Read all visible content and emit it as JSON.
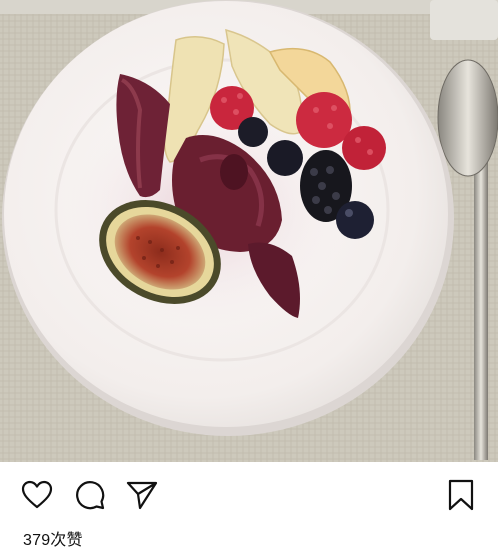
{
  "post": {
    "image_subject": "plate-of-poached-pears-fig-and-berries"
  },
  "actions": {
    "like_icon": "heart-icon",
    "comment_icon": "comment-icon",
    "share_icon": "send-icon",
    "save_icon": "bookmark-icon"
  },
  "likes": {
    "text": "379次赞"
  },
  "colors": {
    "plate": "#f7f3f1",
    "tablecloth": "#cfcbbf",
    "poached_pear": "#6e2236",
    "fig_flesh": "#b3432c",
    "raspberry": "#c9263d",
    "blackberry": "#1b1b22",
    "pear": "#eedfae",
    "icon_stroke": "#111111"
  }
}
